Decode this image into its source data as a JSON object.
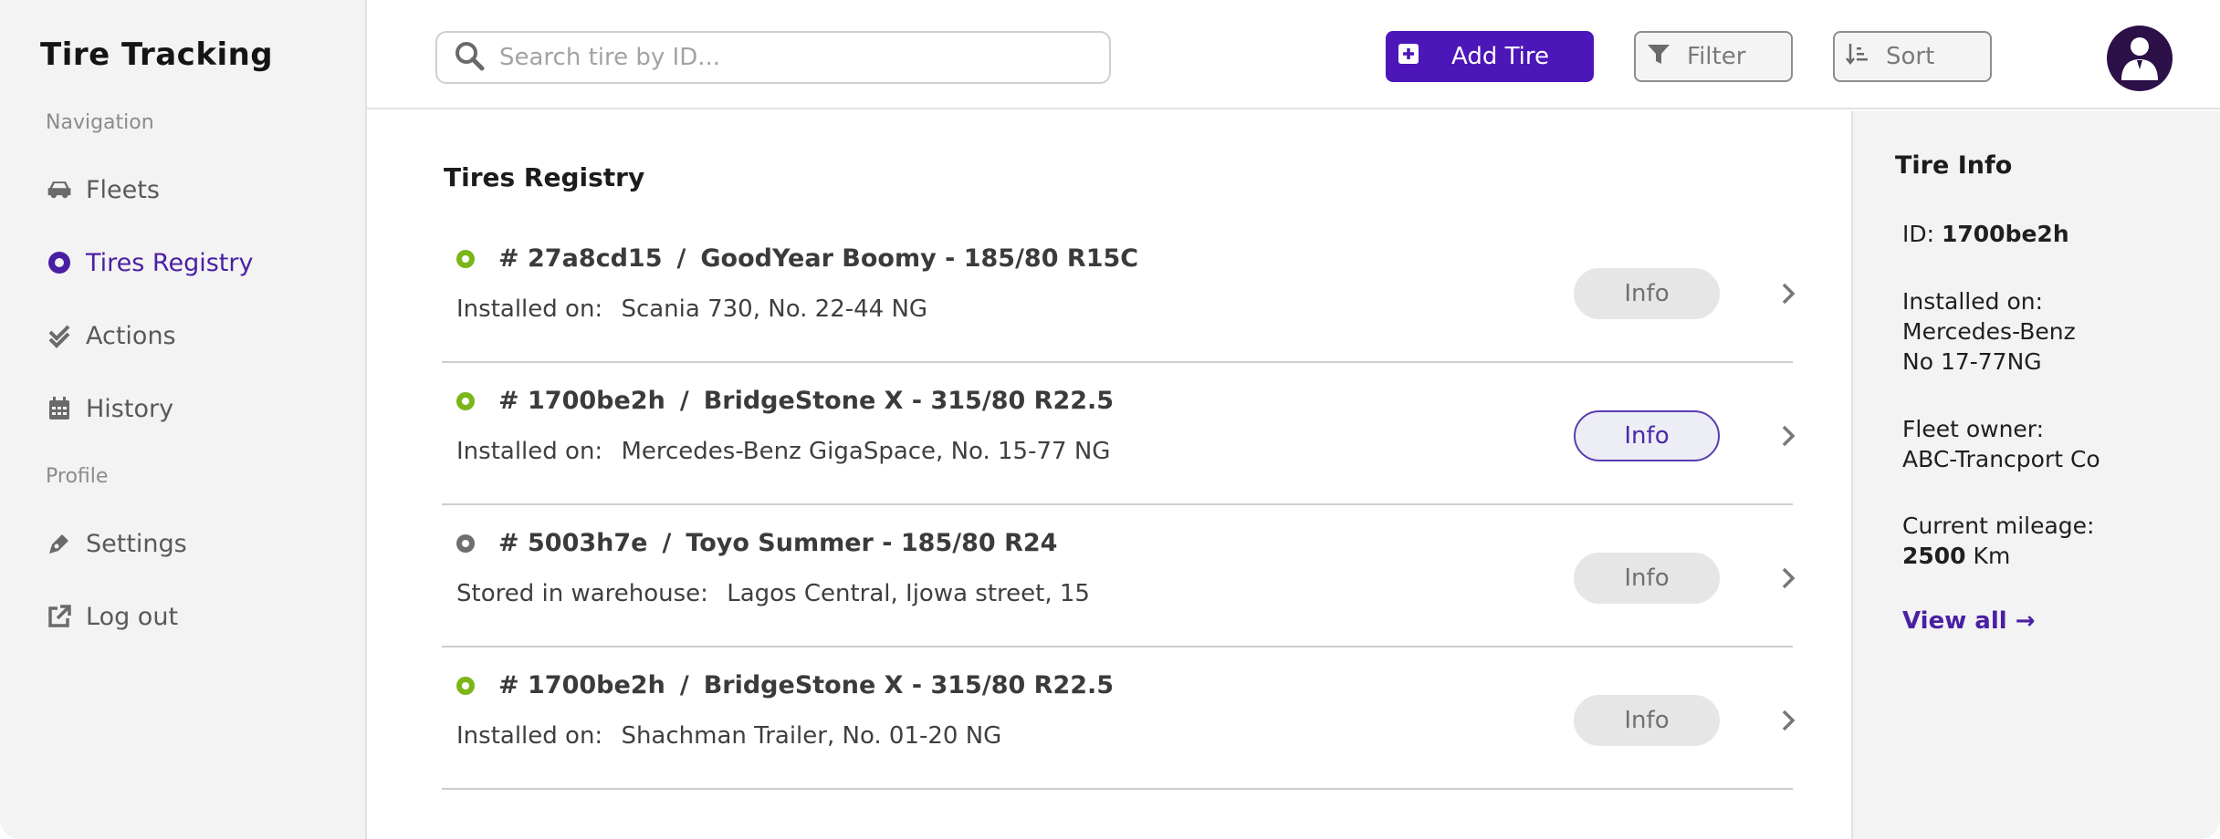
{
  "app": {
    "title": "Tire Tracking"
  },
  "sidebar": {
    "nav_label": "Navigation",
    "profile_label": "Profile",
    "items": [
      {
        "label": "Fleets",
        "icon": "car-icon"
      },
      {
        "label": "Tires Registry",
        "icon": "radio-dot-icon",
        "active": true
      },
      {
        "label": "Actions",
        "icon": "double-check-icon"
      },
      {
        "label": "History",
        "icon": "calendar-icon"
      }
    ],
    "profile_items": [
      {
        "label": "Settings",
        "icon": "pen-icon"
      },
      {
        "label": "Log out",
        "icon": "external-link-icon"
      }
    ]
  },
  "header": {
    "search": {
      "placeholder": "Search tire by ID...",
      "value": ""
    },
    "add_label": "Add Tire",
    "filter_label": "Filter",
    "sort_label": "Sort"
  },
  "main": {
    "title": "Tires Registry",
    "rows": [
      {
        "id": "# 27a8cd15",
        "sep": "/",
        "model": "GoodYear Boomy - 185/80 R15C",
        "sub_label": "Installed on:",
        "sub_value": "Scania 730, No. 22-44 NG",
        "status": "installed",
        "info_label": "Info"
      },
      {
        "id": "# 1700be2h",
        "sep": "/",
        "model": "BridgeStone X - 315/80 R22.5",
        "sub_label": "Installed on:",
        "sub_value": "Mercedes-Benz GigaSpace, No. 15-77 NG",
        "status": "installed",
        "info_label": "Info",
        "selected": true
      },
      {
        "id": "# 5003h7e",
        "sep": "/",
        "model": "Toyo Summer - 185/80 R24",
        "sub_label": "Stored in warehouse:",
        "sub_value": "Lagos Central, Ijowa street, 15",
        "status": "stored",
        "info_label": "Info"
      },
      {
        "id": "# 1700be2h",
        "sep": "/",
        "model": "BridgeStone X - 315/80 R22.5",
        "sub_label": "Installed on:",
        "sub_value": "Shachman Trailer, No. 01-20 NG",
        "status": "installed",
        "info_label": "Info"
      }
    ]
  },
  "colors": {
    "accent": "#4c16b8",
    "installed": "#7cb518",
    "stored": "#6e6e6e"
  },
  "panel": {
    "title": "Tire Info",
    "id_label": "ID:",
    "id_value": "1700be2h",
    "installed_label": "Installed on:",
    "installed_line1": "Mercedes-Benz",
    "installed_line2": "No 17-77NG",
    "owner_label": "Fleet owner:",
    "owner_value": "ABC-Trancport Co",
    "mileage_label": "Current mileage:",
    "mileage_value": "2500",
    "mileage_unit": "Km",
    "view_all": "View all →"
  }
}
